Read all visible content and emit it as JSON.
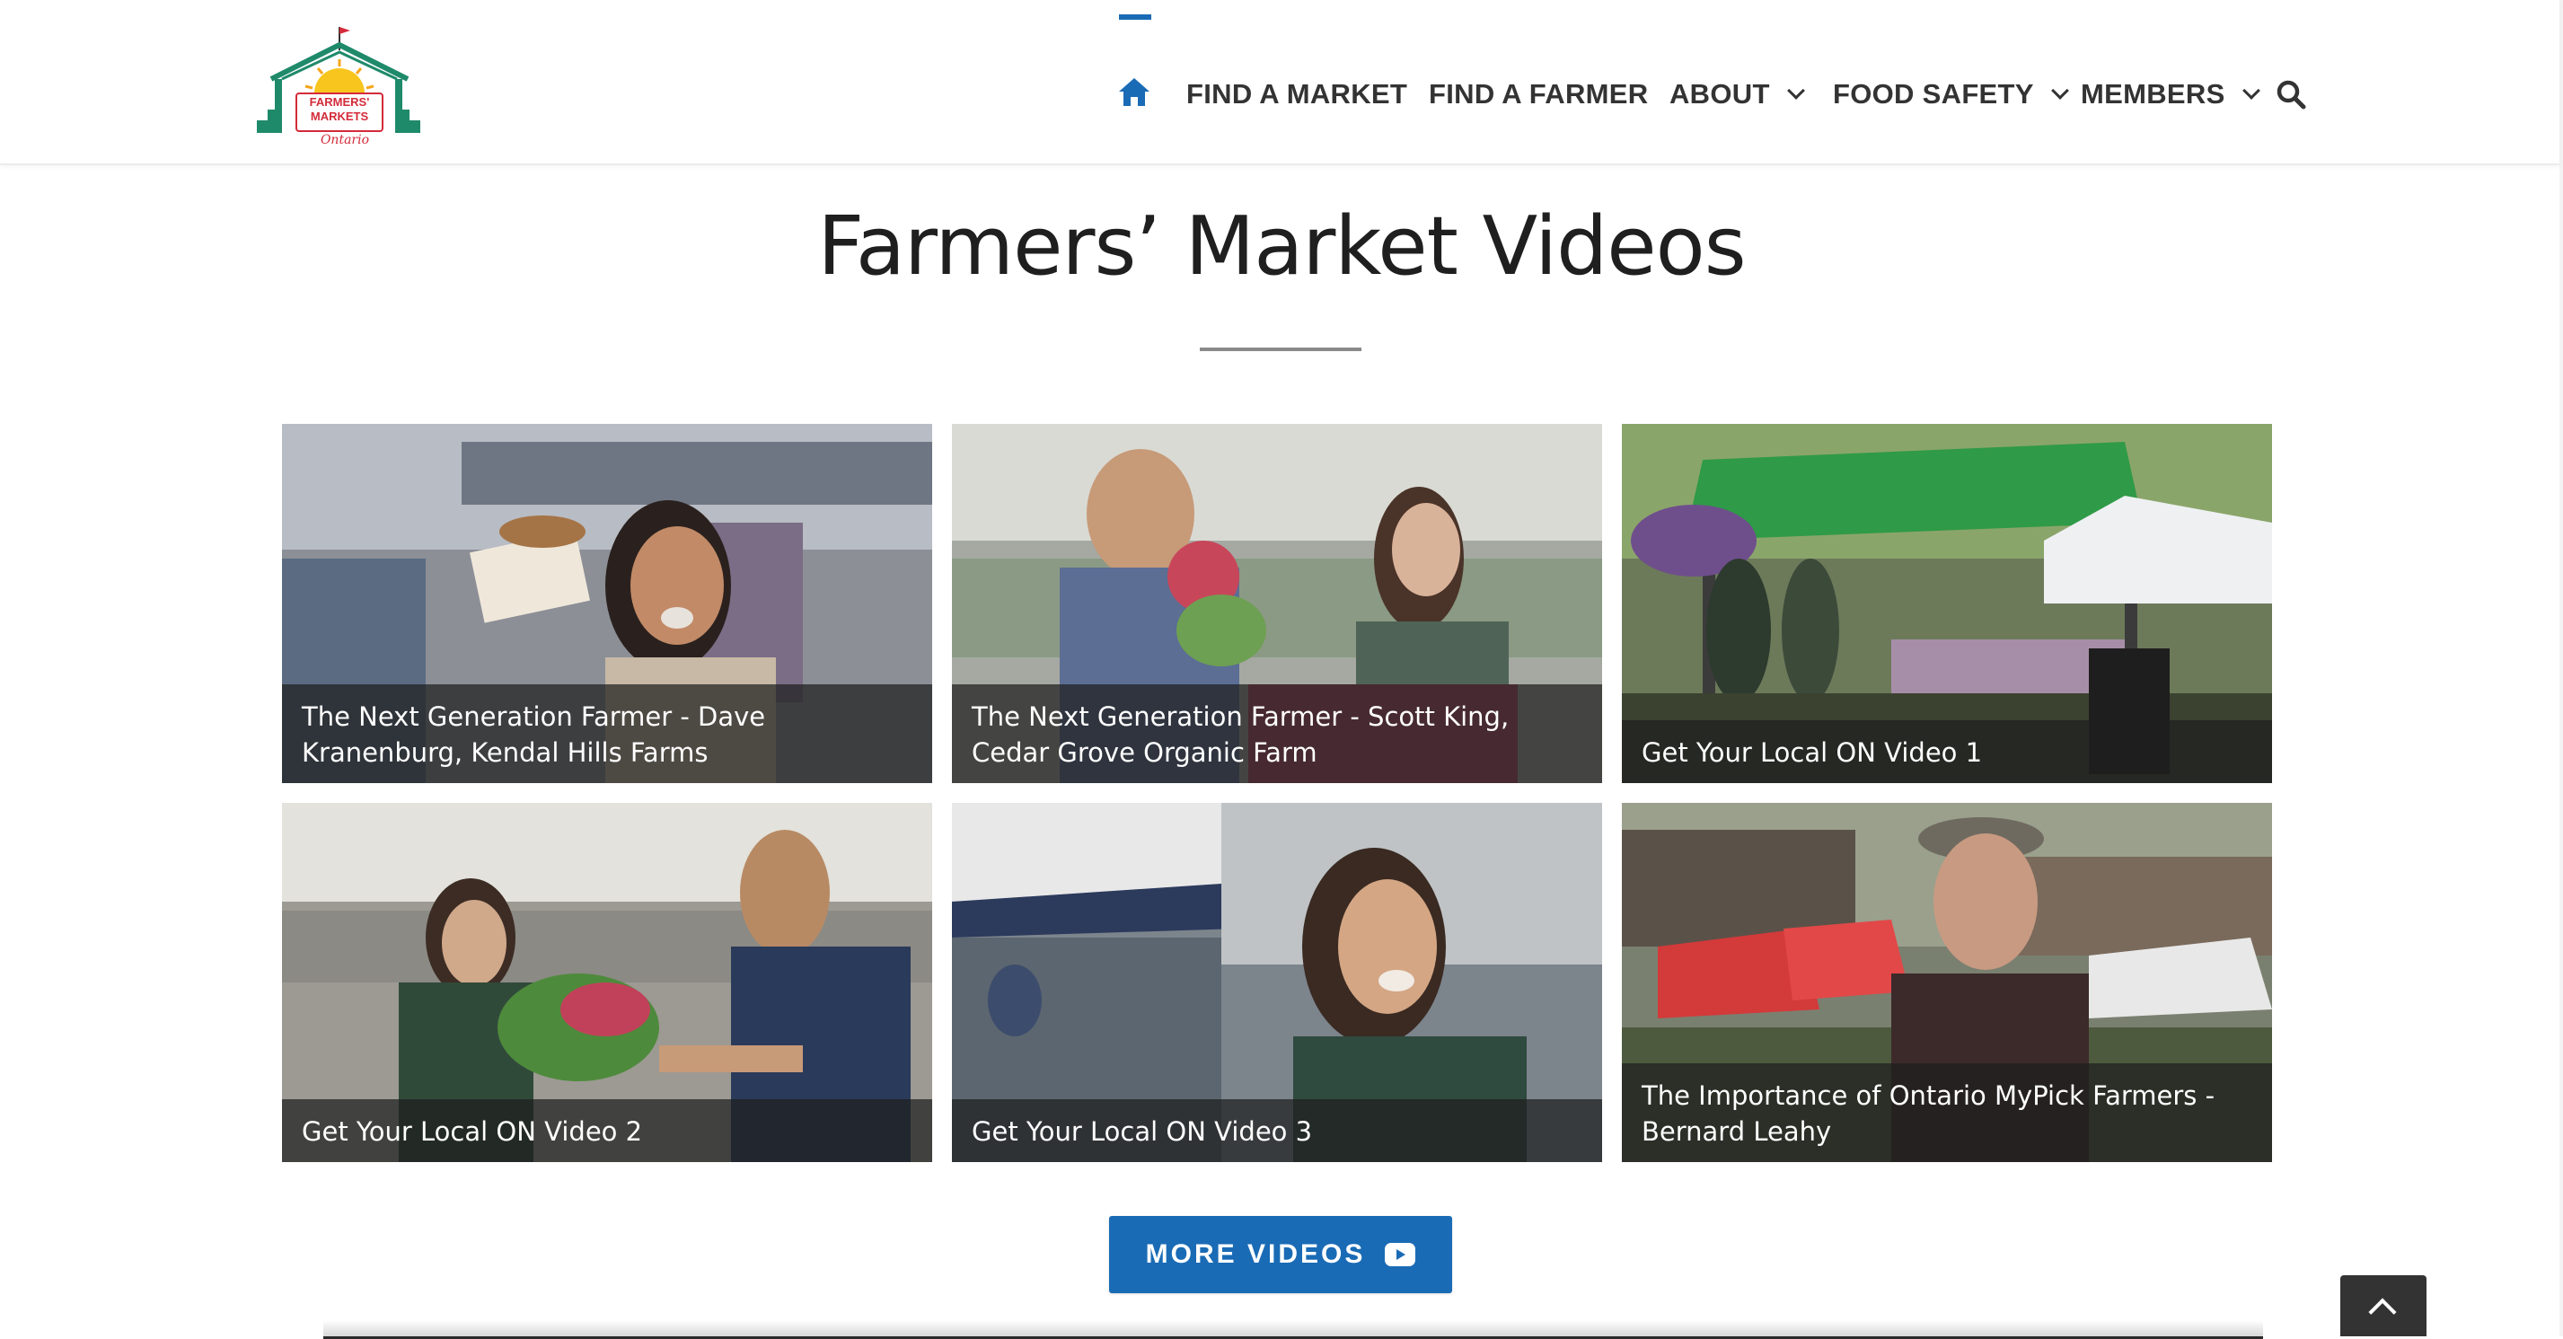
{
  "header": {
    "logo_alt": "Farmers' Markets Ontario",
    "logo_text_line1": "FARMERS'",
    "logo_text_line2": "MARKETS",
    "logo_text_line3": "Ontario",
    "home_icon": "home-icon",
    "nav": [
      {
        "label": "FIND A MARKET",
        "has_dropdown": false
      },
      {
        "label": "FIND A FARMER",
        "has_dropdown": false
      },
      {
        "label": "ABOUT",
        "has_dropdown": true
      },
      {
        "label": "FOOD SAFETY",
        "has_dropdown": true
      },
      {
        "label": "MEMBERS",
        "has_dropdown": true
      }
    ],
    "search_icon": "search-icon",
    "accent_color": "#1a6bb5"
  },
  "main": {
    "title": "Farmers’ Market Videos",
    "videos": [
      {
        "caption": "The Next Generation Farmer - Dave Kranenburg, Kendal Hills Farms"
      },
      {
        "caption": "The Next Generation Farmer - Scott King, Cedar Grove Organic Farm"
      },
      {
        "caption": "Get Your Local ON Video 1"
      },
      {
        "caption": "Get Your Local ON Video 2"
      },
      {
        "caption": "Get Your Local ON Video 3"
      },
      {
        "caption": "The Importance of Ontario MyPick Farmers - Bernard Leahy"
      }
    ],
    "more_button": {
      "label": "MORE VIDEOS",
      "icon": "youtube-icon"
    }
  },
  "back_to_top": {
    "icon": "chevron-up-icon"
  }
}
